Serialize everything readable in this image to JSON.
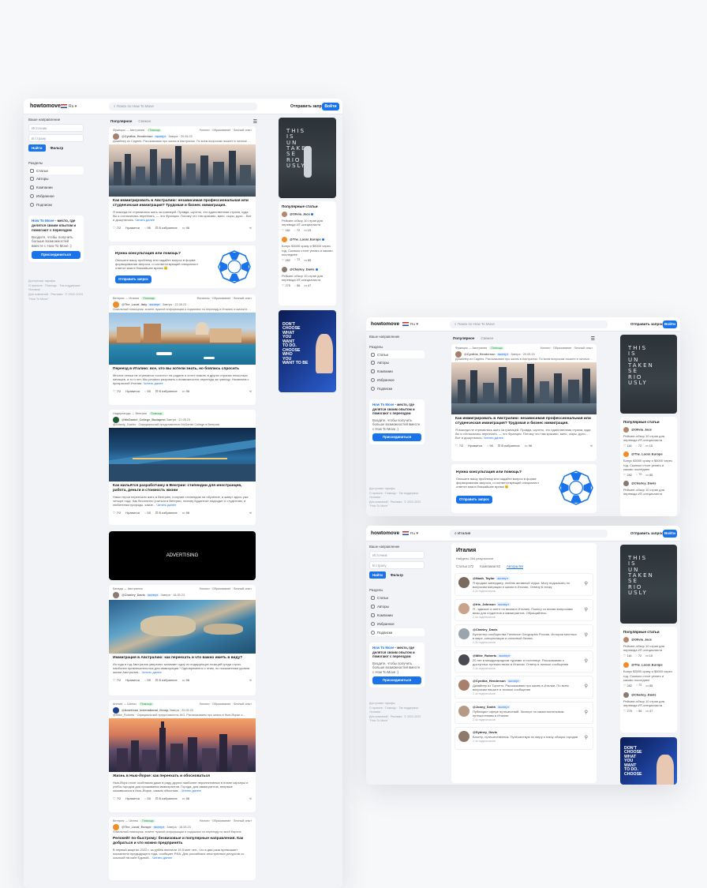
{
  "app": {
    "logo": "howtomove",
    "lang": "Ru",
    "search_placeholder": "Поиск по How To Move",
    "send_request": "Отправить запрос",
    "login": "Войти"
  },
  "sidebar": {
    "direction_label": "Ваше направление",
    "from_placeholder": "Истoчник",
    "to_placeholder": "В страну",
    "find": "Найти",
    "filter": "Фильтр",
    "sections_label": "Разделы",
    "items": [
      "Статьи",
      "Авторы",
      "Компании",
      "Избранное",
      "Подписки"
    ],
    "promo_title": "How To Move",
    "promo_rest": " - место, где делятся своим опытом и помогают с переездом",
    "promo_desc": "Входите, чтобы получить больше возможностей вместе с How To Move :)",
    "promo_btn": "Присоединиться",
    "foot": [
      "Доступные тарифы",
      "О проекте · Помощь · Так поддержка · Условия",
      "Для компаний · Реклама · © 2022-2023 \"How To Move\""
    ]
  },
  "feed": {
    "tab_popular": "Популярное",
    "tab_new": "Свежее",
    "posts": [
      {
        "route": "Франция → Австралия",
        "tag": "Помощь",
        "cats": "Налоги · Образование · Личный опыт",
        "author": "@Cynthia_Henderson",
        "badge": "эксперт",
        "date": "Завтра · 20.05.23",
        "note": "Дизайнер из Сиднея. Рассказываю про жизнь в Австралии. По всем вопросам пишите в личные сообщения",
        "title": "Как иммигрировать в Австралию: независимая профессиональная или студенческая иммиграция? Трудовая и бизнес иммиграция.",
        "excerpt": "Я никогда не стремилась жить за границей. Правда, шучтно, это единственная страна, куда бы я согласилась переехать, — это Франция. Потому что там красиво, вино, сыры, духи... Вот и дошутилась.",
        "more": "Читать далее",
        "likes": "7/2",
        "likes_label": "Нравится",
        "comments": "96",
        "fav": "В избранное",
        "views": "96"
      },
      {
        "route": "Венгрия → Италия",
        "tag": "Помощь",
        "cats": "Финансы · Образование · Личный опыт",
        "author": "@The_Local_Italy",
        "badge": "эксперт",
        "date": "Завтра · 22.05.23",
        "note": "Локальный помощник: знаете нужной информации и подсказок по переезду в Италию и жизни в Италии",
        "title": "Переезд в Италию: все, что вы хотели знать, но боялись спросить",
        "excerpt": "Многие семьи не стремятся «осесть» на родине и хотят пожить в других странах несколько месяцев, а то и лет. Мы решили разузнать о возможностях переезда за границу. Начинаем с прекрасной Италии.",
        "more": "Читать далее",
        "likes": "7/2",
        "likes_label": "Нравится",
        "comments": "55",
        "fav": "В избранное",
        "views": "96"
      },
      {
        "route": "Нидерланды → Венгрия",
        "tag": "Помощь",
        "cats": "Финансы · Личный опыт",
        "author": "@McDaniel_College_Budapest",
        "badge": "",
        "date": "Завтра · 22.05.23",
        "note": "@Udaniy_Gastro · Официальный представитель McDaniel College в Венгрии",
        "title": "Как жильётся разработчику в Венгрии: стипендии для иностранцев, работа, деньги и стоимость жизни",
        "excerpt": "Наши герои переехали жить в Венгрию, получив стипендию на обучение, и живут здесь уже четыре года. Как бесплатно учиться в Венгрии, почему Будапешт подходит и студентам, и любителям природы, какие...",
        "more": "Читать далее",
        "likes": "7/2",
        "likes_label": "Нравится",
        "comments": "55",
        "fav": "В избранное",
        "views": "96"
      },
      {
        "route": "Канада → Австралия",
        "tag": "",
        "cats": "Налоги · Образование · Личный опыт",
        "author": "@Charley_Davis",
        "badge": "эксперт",
        "date": "Завтра · 18.05.23",
        "note": "",
        "title": "Иммиграция в Австралию: как переехать и что важно иметь в виду?",
        "excerpt": "Из года в год Австралия уверенно занимает одну из лидирующих позиций среди стран, наиболее привлекательных для иммиграции.¹ Одновременно с этим, по показателям уровня жизни Австралия...",
        "more": "Читать далее",
        "likes": "7/2",
        "likes_label": "Нравится",
        "comments": "55",
        "fav": "В избранное",
        "views": "96"
      },
      {
        "route": "Англия → Штаты",
        "tag": "Помощь",
        "cats": "Налоги · Образование · Личный опыт",
        "author": "@American_International_Group",
        "badge": "",
        "date": "Завтра · 20.05.23",
        "note": "@Mike_Roberts · Официальный представитель AIG. Рассказываем про жизнь в Нью-Йорке и...",
        "title": "Жизнь в Нью-Йорке: как переехать и обосноваться",
        "excerpt": "Нью-Йорк стоит особняком даже в ряду других наиболее перспективных в плане карьеры и учёбы городов для проживания иммигрантов. Города, для иммигрантов, впервые оказавшихся в Нью-Йорке, самым обычным...",
        "more": "Читать далее",
        "likes": "7/2",
        "likes_label": "Нравится",
        "comments": "55",
        "fav": "В избранное",
        "views": "96"
      },
      {
        "route": "Венгрия → Штаты",
        "tag": "Помощь",
        "cats": "Налоги · Образование · Личный опыт",
        "author": "@The_Local_Europe",
        "badge": "эксперт",
        "date": "Завтра · 18.05.23",
        "note": "Локальный помощник: знаете нужной информации и подсказок по переезду по всей Европе",
        "title": "Релокейт по-быстрому: безвизовые и популярные направления. Как добраться и что можно предпринять",
        "excerpt": "В первый квартал 2022 г. за рубеж выехали 15,5 млн чел., что в два раза превышает показатели предыдущего года, сообщает РИА. Для российских иностранных ресурсов со ссылкой на сайт Единой...",
        "more": "Читать далее",
        "likes": "",
        "likes_label": "",
        "comments": "",
        "fav": "",
        "views": ""
      }
    ],
    "consult_title": "Нужна консультация или помощь?",
    "consult_text": "Опишите вашу проблему или задайте вопрос в форме формирования запроса, и соответствующий специалист ответит вам в ближайшее время 😊",
    "consult_btn": "Отправить запрос",
    "ad": "ADVERTISING"
  },
  "right": {
    "poster1": [
      "THIS",
      "IS",
      "UN",
      "TAKEN",
      "SE",
      "RIO",
      "USLY"
    ],
    "popular_title": "Популярные статьи",
    "popular": [
      {
        "author": "@Olivia_Jace",
        "text": "Рейсинг-обзор 10 стран для перевода ИТ-специалиста",
        "likes": "116",
        "comments": "72",
        "views": "15"
      },
      {
        "author": "@The_Local_Europe",
        "text": "Бонус $3000 сразу и $5000 через год. Сколько стоит уехать и каково последнее",
        "likes": "282",
        "comments": "72",
        "views": "85"
      },
      {
        "author": "@Charley_Davis",
        "text": "Рейсинг-обзор 10 стран для перевода ИТ-специалиста",
        "likes": "275",
        "comments": "56",
        "views": "47"
      }
    ],
    "poster2": [
      "DON'T",
      "CHOOSE",
      "WHAT",
      "YOU",
      "WANT",
      "TO DO.",
      "CHOOSE",
      "WHO",
      "YOU",
      "WANT TO BE"
    ]
  },
  "search": {
    "query": "Италия",
    "title": "Италия",
    "results": "Найдено 284 результатов",
    "tabs": [
      "Статьи 172",
      "Компании 62",
      "Авторы 56"
    ],
    "authors": [
      {
        "name": "@Noah_Taylor",
        "badge": "эксперт",
        "text": "Я продакт-менеджер, люблю активный отдых. Могу подсказать по вопросам миграции и жизни в Италии, Отвечу в личку",
        "subs": "2,2к подписчиков"
      },
      {
        "name": "@Iris_Johnson",
        "badge": "эксперт",
        "text": "Я - адвокат и агент по визам в Италию. Помогу со всеми вопросами визы для студентов и иммигрантов. Обращайтесь.",
        "subs": "2,4к подписчиков"
      },
      {
        "name": "@Charley_Davis",
        "badge": "",
        "text": "Бухгалтер сообщества Freelance Geographic Россия. Истории местных в мире, консультации и оплатный бизнес.",
        "subs": "2,2к подписчиков"
      },
      {
        "name": "@Mike_Roberts",
        "badge": "эксперт",
        "text": "20 лет в международном туризме и гостинице. Рассказываю о доступных путешествиях в Италию. Отвечу в личные сообщения",
        "subs": "2,4к подписчиков"
      },
      {
        "name": "@Cynthia_Henderson",
        "badge": "эксперт",
        "text": "Дизайнер из Торонто. Рассказываю про жизнь в Италии. По всем вопросам пишите в личные сообщения",
        "subs": "2,4к подписчиков"
      },
      {
        "name": "@Jonny_Smith",
        "badge": "эксперт",
        "text": "Публицист сфере путешествий. Эксперт по самостоятельным путешествиям в Италию",
        "subs": "2,4к подписчиков"
      },
      {
        "name": "@Sydney_Davis",
        "badge": "",
        "text": "Блогер, путешественник. Путешествую по миру и пишу обзоры городов",
        "subs": "2,4к подписчиков"
      }
    ]
  },
  "colors": {
    "accent": "#1a73e8",
    "green": "#2a9d4a",
    "bg": "#f1f3f6"
  }
}
